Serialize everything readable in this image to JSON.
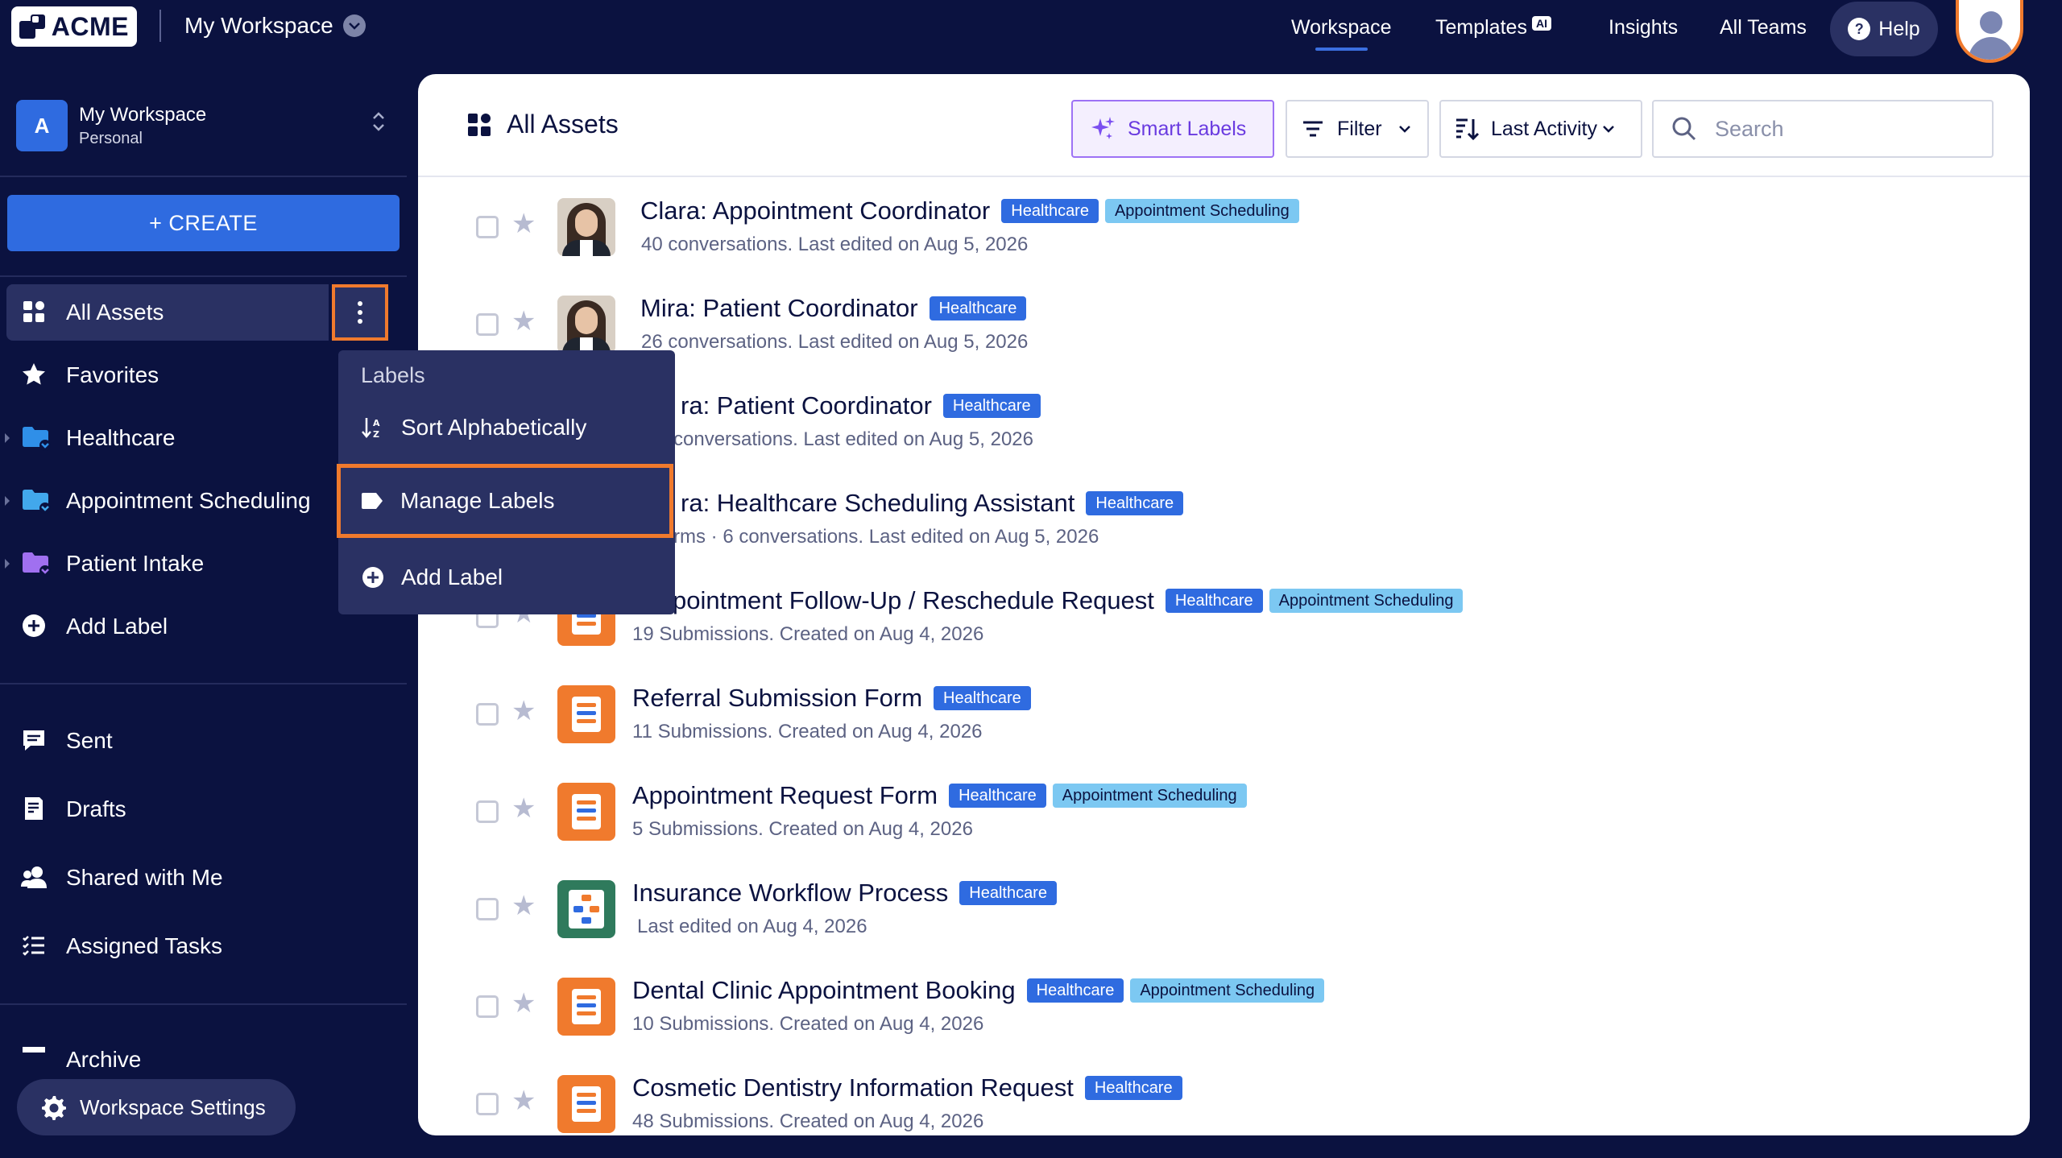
{
  "brand": {
    "name": "ACME"
  },
  "header": {
    "workspace_title": "My Workspace",
    "nav": [
      {
        "label": "Workspace",
        "active": true
      },
      {
        "label": "Templates",
        "badge": "AI"
      },
      {
        "label": "Insights"
      },
      {
        "label": "All Teams"
      }
    ],
    "help_label": "Help"
  },
  "sidebar": {
    "workspace_name": "My Workspace",
    "workspace_type": "Personal",
    "workspace_initial": "A",
    "create_label": "+ CREATE",
    "items": [
      {
        "label": "All Assets",
        "icon": "grid-icon"
      },
      {
        "label": "Favorites",
        "icon": "star-icon"
      },
      {
        "label": "Healthcare",
        "icon": "label-folder-icon",
        "color": "#2f8fe8"
      },
      {
        "label": "Appointment Scheduling",
        "icon": "label-folder-icon",
        "color": "#42a8ec"
      },
      {
        "label": "Patient Intake",
        "icon": "label-folder-icon",
        "color": "#a070f0"
      },
      {
        "label": "Add Label",
        "icon": "plus-circle-icon"
      }
    ],
    "secondary": [
      {
        "label": "Sent",
        "icon": "sent-icon"
      },
      {
        "label": "Drafts",
        "icon": "drafts-icon"
      },
      {
        "label": "Shared with Me",
        "icon": "shared-icon"
      },
      {
        "label": "Assigned Tasks",
        "icon": "tasks-icon"
      }
    ],
    "partial_item": "Archive",
    "settings_label": "Workspace Settings"
  },
  "menu": {
    "heading": "Labels",
    "items": [
      {
        "label": "Sort Alphabetically",
        "icon": "sort-az-icon"
      },
      {
        "label": "Manage Labels",
        "icon": "label-tag-icon",
        "highlighted": true
      },
      {
        "label": "Add Label",
        "icon": "plus-circle-icon"
      }
    ]
  },
  "main": {
    "title": "All Assets",
    "smart_labels_label": "Smart Labels",
    "filter_label": "Filter",
    "sort_label": "Last Activity",
    "search_placeholder": "Search",
    "tag_labels": {
      "healthcare": "Healthcare",
      "appointment": "Appointment Scheduling"
    },
    "rows": [
      {
        "title": "Clara: Appointment Coordinator",
        "subtitle": "40 conversations. Last edited on Aug 5, 2026",
        "thumb": "photo",
        "tags": [
          "Healthcare",
          "Appointment Scheduling"
        ]
      },
      {
        "title": "Mira: Patient Coordinator",
        "subtitle": "26 conversations. Last edited on Aug 5, 2026",
        "thumb": "photo",
        "tags": [
          "Healthcare"
        ]
      },
      {
        "title": "ra: Patient Coordinator",
        "subtitle": "conversations. Last edited on Aug 5, 2026",
        "thumb": "hidden",
        "tags": [
          "Healthcare"
        ]
      },
      {
        "title": "ra: Healthcare Scheduling Assistant",
        "subtitle": "rms · 6 conversations. Last edited on Aug 5, 2026",
        "thumb": "hidden",
        "tags": [
          "Healthcare"
        ]
      },
      {
        "title": "pointment Follow-Up / Reschedule Request",
        "subtitle": "19 Submissions. Created on Aug 4, 2026",
        "thumb": "form",
        "tags": [
          "Healthcare",
          "Appointment Scheduling"
        ]
      },
      {
        "title": "Referral Submission Form",
        "subtitle": "11 Submissions. Created on Aug 4, 2026",
        "thumb": "form",
        "tags": [
          "Healthcare"
        ]
      },
      {
        "title": "Appointment Request Form",
        "subtitle": "5 Submissions. Created on Aug 4, 2026",
        "thumb": "form",
        "tags": [
          "Healthcare",
          "Appointment Scheduling"
        ]
      },
      {
        "title": "Insurance Workflow Process",
        "subtitle": "Last edited on Aug 4, 2026",
        "thumb": "workflow",
        "tags": [
          "Healthcare"
        ]
      },
      {
        "title": "Dental Clinic Appointment Booking",
        "subtitle": "10 Submissions. Created on Aug 4, 2026",
        "thumb": "form",
        "tags": [
          "Healthcare",
          "Appointment Scheduling"
        ]
      },
      {
        "title": "Cosmetic Dentistry Information Request",
        "subtitle": "48 Submissions. Created on Aug 4, 2026",
        "thumb": "form",
        "tags": [
          "Healthcare"
        ]
      }
    ]
  }
}
